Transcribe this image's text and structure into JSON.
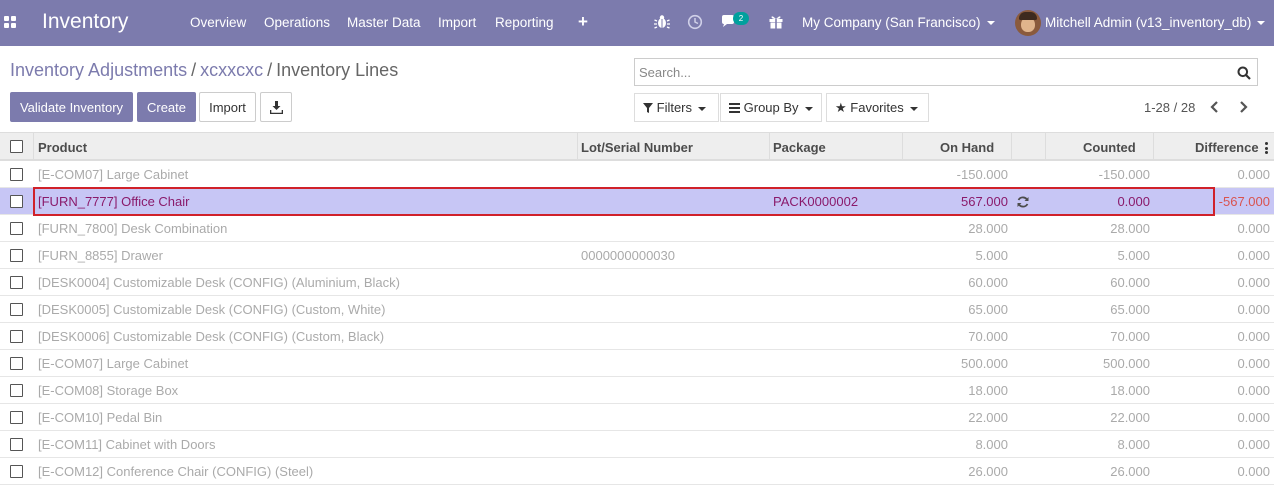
{
  "navbar": {
    "brand": "Inventory",
    "menu": [
      "Overview",
      "Operations",
      "Master Data",
      "Import",
      "Reporting"
    ],
    "plus": "+",
    "chat_count": "2",
    "company": "My Company (San Francisco)",
    "user": "Mitchell Admin (v13_inventory_db)",
    "icons": [
      "apps-grid-icon",
      "bug-icon",
      "clock-icon",
      "chat-icon",
      "gift-icon"
    ]
  },
  "breadcrumb": {
    "items": [
      "Inventory Adjustments",
      "xcxxcxc"
    ],
    "separator": "/",
    "current": "Inventory Lines"
  },
  "search": {
    "placeholder": "Search..."
  },
  "buttons": {
    "validate": "Validate Inventory",
    "create": "Create",
    "import": "Import"
  },
  "filters": {
    "filters": "Filters",
    "group_by": "Group By",
    "favorites": "Favorites"
  },
  "pager": {
    "value": "1-28 / 28"
  },
  "table": {
    "columns": [
      "Product",
      "Lot/Serial Number",
      "Package",
      "On Hand",
      "Counted",
      "Difference"
    ],
    "rows": [
      {
        "product": "[E-COM07] Large Cabinet",
        "lot": "",
        "package": "",
        "on_hand": "-150.000",
        "counted": "-150.000",
        "difference": "0.000"
      },
      {
        "product": "[FURN_7777] Office Chair",
        "lot": "",
        "package": "PACK0000002",
        "on_hand": "567.000",
        "counted": "0.000",
        "difference": "-567.000"
      },
      {
        "product": "[FURN_7800] Desk Combination",
        "lot": "",
        "package": "",
        "on_hand": "28.000",
        "counted": "28.000",
        "difference": "0.000"
      },
      {
        "product": "[FURN_8855] Drawer",
        "lot": "0000000000030",
        "package": "",
        "on_hand": "5.000",
        "counted": "5.000",
        "difference": "0.000"
      },
      {
        "product": "[DESK0004] Customizable Desk (CONFIG) (Aluminium, Black)",
        "lot": "",
        "package": "",
        "on_hand": "60.000",
        "counted": "60.000",
        "difference": "0.000"
      },
      {
        "product": "[DESK0005] Customizable Desk (CONFIG) (Custom, White)",
        "lot": "",
        "package": "",
        "on_hand": "65.000",
        "counted": "65.000",
        "difference": "0.000"
      },
      {
        "product": "[DESK0006] Customizable Desk (CONFIG) (Custom, Black)",
        "lot": "",
        "package": "",
        "on_hand": "70.000",
        "counted": "70.000",
        "difference": "0.000"
      },
      {
        "product": "[E-COM07] Large Cabinet",
        "lot": "",
        "package": "",
        "on_hand": "500.000",
        "counted": "500.000",
        "difference": "0.000"
      },
      {
        "product": "[E-COM08] Storage Box",
        "lot": "",
        "package": "",
        "on_hand": "18.000",
        "counted": "18.000",
        "difference": "0.000"
      },
      {
        "product": "[E-COM10] Pedal Bin",
        "lot": "",
        "package": "",
        "on_hand": "22.000",
        "counted": "22.000",
        "difference": "0.000"
      },
      {
        "product": "[E-COM11] Cabinet with Doors",
        "lot": "",
        "package": "",
        "on_hand": "8.000",
        "counted": "8.000",
        "difference": "0.000"
      },
      {
        "product": "[E-COM12] Conference Chair (CONFIG) (Steel)",
        "lot": "",
        "package": "",
        "on_hand": "26.000",
        "counted": "26.000",
        "difference": "0.000"
      }
    ]
  },
  "colors": {
    "brand": "#7c7bad",
    "selected_row": "#c7c6f5",
    "selected_text": "#8a1a6b",
    "negative": "#d9534f",
    "highlight_border": "#d0212a"
  }
}
